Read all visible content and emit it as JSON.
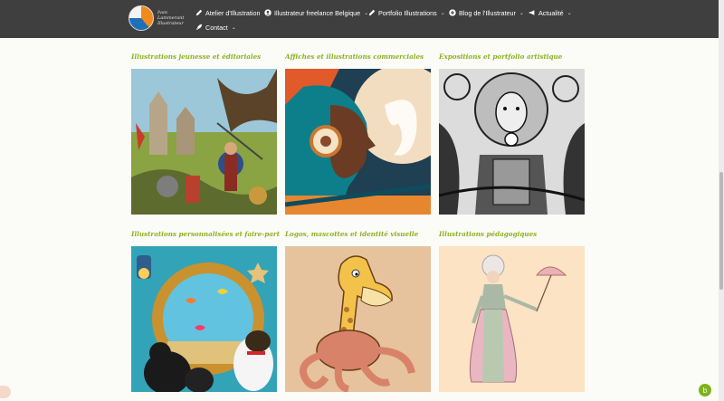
{
  "logo": {
    "line1": "Ivan Lammerant",
    "line2": "Illustrateur"
  },
  "nav": [
    {
      "label": "Atelier d'Illustration",
      "icon": "pencil-icon",
      "has_dropdown": false
    },
    {
      "label": "Illustrateur freelance Belgique",
      "icon": "user-icon",
      "has_dropdown": true
    },
    {
      "label": "Portfolio Illustrations",
      "icon": "pencil-icon",
      "has_dropdown": true
    },
    {
      "label": "Blog de l'Illustrateur",
      "icon": "plus-circle-icon",
      "has_dropdown": true
    },
    {
      "label": "Actualité",
      "icon": "megaphone-icon",
      "has_dropdown": true
    },
    {
      "label": "Contact",
      "icon": "rocket-icon",
      "has_dropdown": true
    }
  ],
  "chevron": "⌄",
  "cards": [
    {
      "title": "Illustrations jeunesse et éditoriales"
    },
    {
      "title": "Affiches et illustrations commerciales"
    },
    {
      "title": "Expositions et portfolio artistique"
    },
    {
      "title": "Illustrations personnalisées et faire-part"
    },
    {
      "title": "Logos, mascottes et identité visuelle"
    },
    {
      "title": "Illustrations pédagogiques"
    }
  ],
  "colors": {
    "topbar": "#3f3f3f",
    "title_green": "#8cb21f",
    "page_bg": "#fbfbf8"
  },
  "chat_button_glyph": "b"
}
